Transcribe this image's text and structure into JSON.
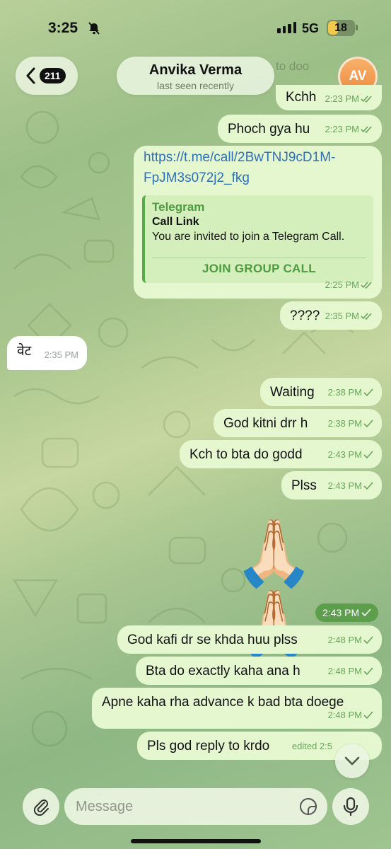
{
  "status_bar": {
    "time": "3:25",
    "network": "5G",
    "battery": "18"
  },
  "header": {
    "back_count": "211",
    "contact_name": "Anvika Verma",
    "contact_status": "last seen recently",
    "avatar_initials": "AV",
    "ghost_text": "to doo"
  },
  "messages": [
    {
      "text": "Kchh",
      "time": "2:23 PM",
      "direction": "out"
    },
    {
      "text": "Phoch gya hu",
      "time": "2:23 PM",
      "direction": "out"
    },
    {
      "link_line1": "https://t.me/call/2BwTNJ9cD1M-",
      "link_line2": "FpJM3s072j2_fkg",
      "preview_site": "Telegram",
      "preview_title": "Call Link",
      "preview_desc": "You are invited to join a Telegram Call.",
      "preview_button": "JOIN GROUP CALL",
      "time": "2:25 PM",
      "direction": "out"
    },
    {
      "text": "????",
      "time": "2:35 PM",
      "direction": "out"
    },
    {
      "text": "वेट",
      "time": "2:35 PM",
      "direction": "in"
    },
    {
      "text": "Waiting",
      "time": "2:38 PM",
      "direction": "out"
    },
    {
      "text": "God kitni drr h",
      "time": "2:38 PM",
      "direction": "out"
    },
    {
      "text": "Kch to bta do godd",
      "time": "2:43 PM",
      "direction": "out"
    },
    {
      "text": "Plss",
      "time": "2:43 PM",
      "direction": "out"
    },
    {
      "text": "🙏🏻🙏🏻",
      "time": "2:43 PM",
      "direction": "out"
    },
    {
      "text": "God kafi dr se khda huu plss",
      "time": "2:48 PM",
      "direction": "out"
    },
    {
      "text": "Bta do exactly kaha ana h",
      "time": "2:48 PM",
      "direction": "out"
    },
    {
      "text": "Apne kaha rha advance k bad bta doege",
      "time": "2:48 PM",
      "direction": "out"
    },
    {
      "text": "Pls god reply to krdo",
      "time": "edited 2:5",
      "direction": "out"
    }
  ],
  "composer": {
    "placeholder": "Message"
  },
  "colors": {
    "outgoing_bubble": "#e4f7cf",
    "incoming_bubble": "#ffffff",
    "accent_green": "#58a94a",
    "link_blue": "#2f6fb5"
  }
}
